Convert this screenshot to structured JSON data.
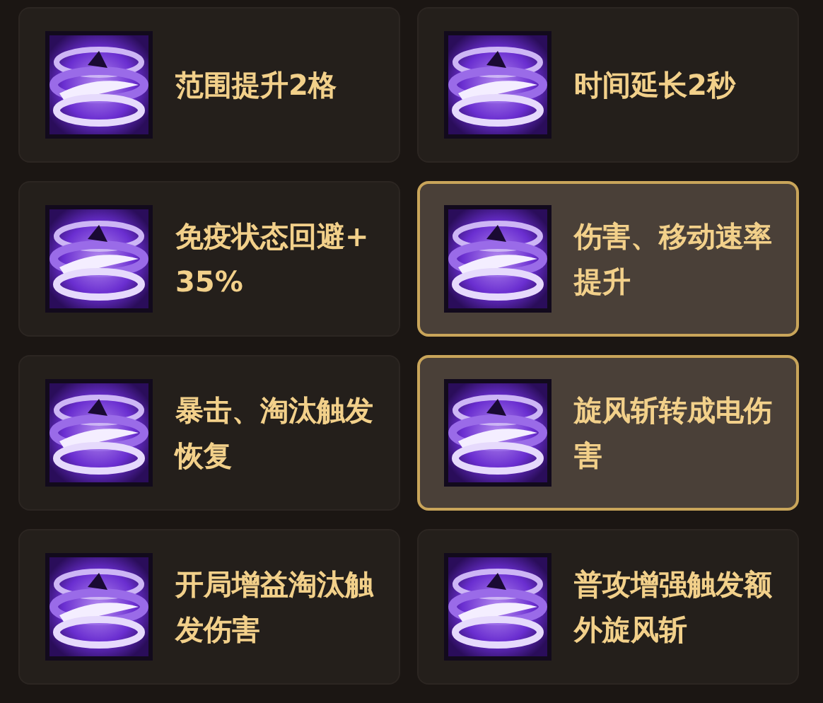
{
  "upgrades": [
    {
      "label": "范围提升2格",
      "selected": false
    },
    {
      "label": "时间延长2秒",
      "selected": false
    },
    {
      "label": "免疫状态回避+35%",
      "selected": false
    },
    {
      "label": "伤害、移动速率提升",
      "selected": true
    },
    {
      "label": "暴击、淘汰触发恢复",
      "selected": false
    },
    {
      "label": "旋风斩转成电伤害",
      "selected": true
    },
    {
      "label": "开局增益淘汰触发伤害",
      "selected": false
    },
    {
      "label": "普攻增强触发额外旋风斩",
      "selected": false
    }
  ]
}
